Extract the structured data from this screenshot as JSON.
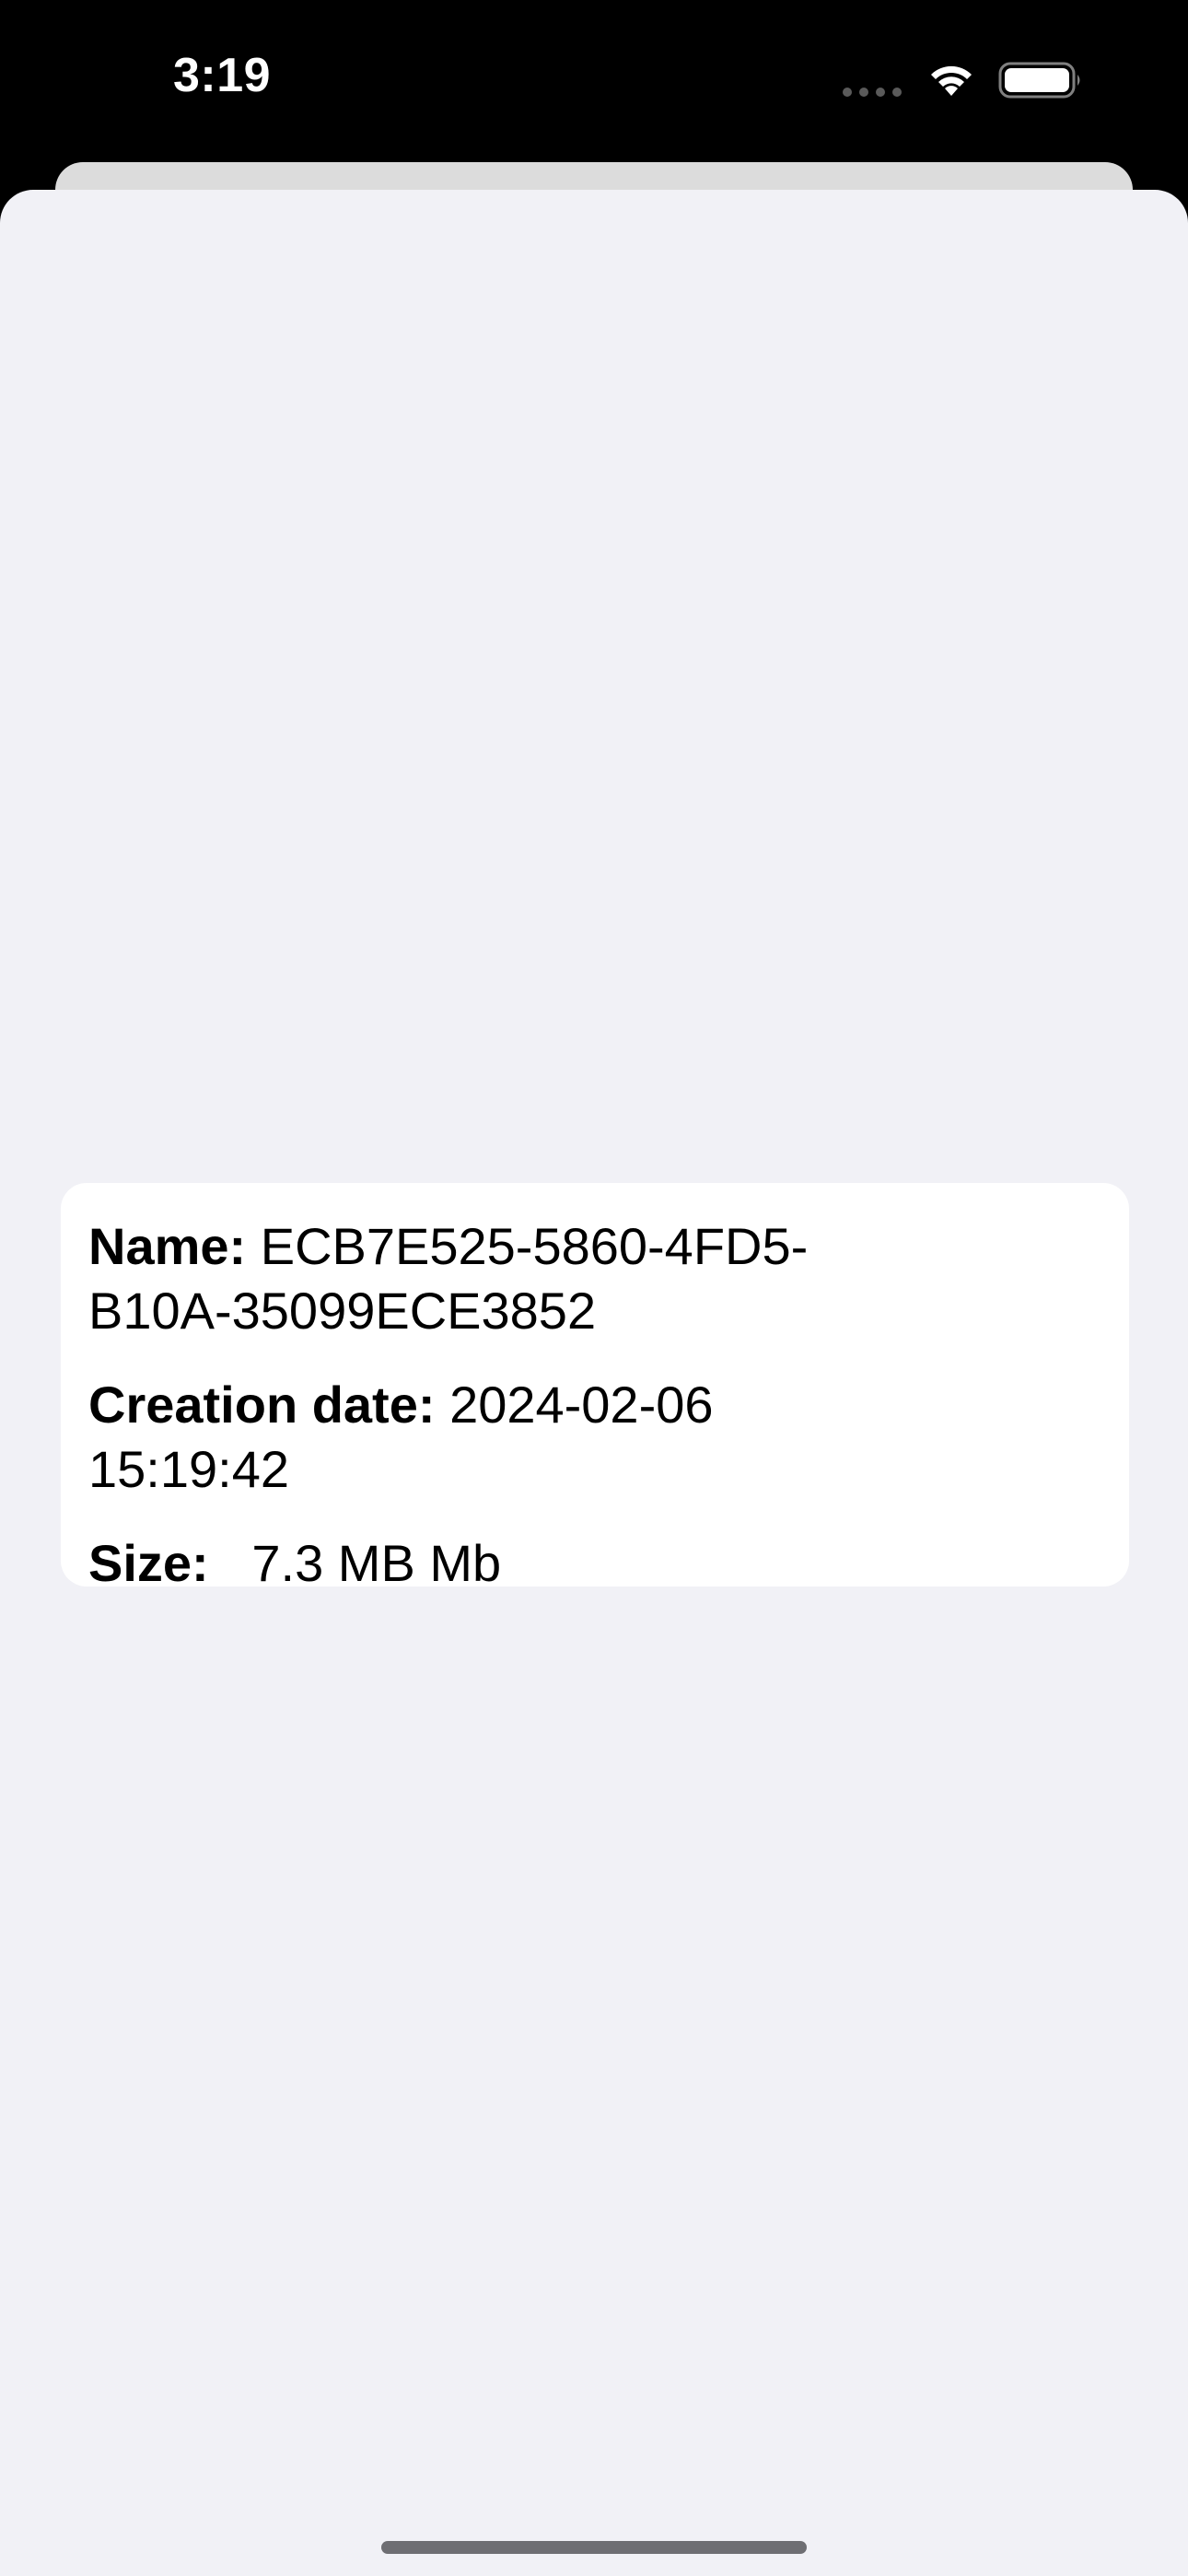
{
  "status_bar": {
    "time": "3:19"
  },
  "file_info": {
    "name_label": "Name:",
    "name_value": "ECB7E525-5860-4FD5-B10A-35099ECE3852",
    "creation_date_label": "Creation date:",
    "creation_date_value": "2024-02-06 15:19:42",
    "size_label": "Size:",
    "size_value": "7.3 MB Mb"
  },
  "colors": {
    "status_bar_background": "#000000",
    "sheet_background": "#f1f1f6",
    "card_background": "#ffffff",
    "text": "#000000"
  }
}
